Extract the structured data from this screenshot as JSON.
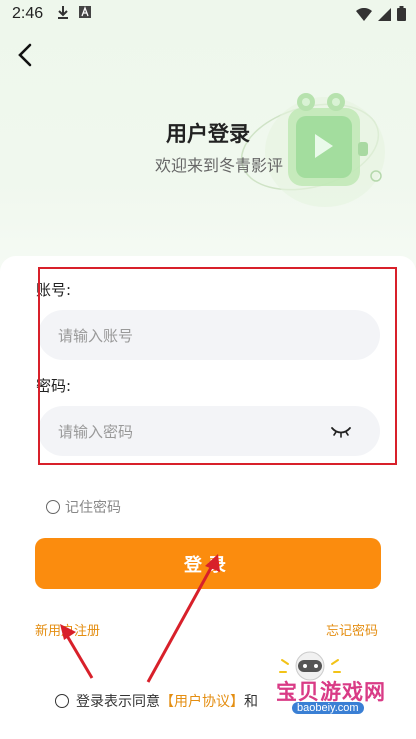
{
  "status_bar": {
    "time": "2:46"
  },
  "header": {
    "title": "用户登录",
    "subtitle": "欢迎来到冬青影评"
  },
  "form": {
    "account_label": "账号:",
    "account_placeholder": "请输入账号",
    "password_label": "密码:",
    "password_placeholder": "请输入密码",
    "remember_label": "记住密码",
    "login_button": "登录",
    "register_link": "新用户注册",
    "forgot_link": "忘记密码"
  },
  "agreement": {
    "prefix": "登录表示同意",
    "user_agreement": "【用户协议】",
    "suffix": "和"
  },
  "watermark": {
    "text": "宝贝游戏网",
    "url": "baobeiy.com"
  },
  "colors": {
    "accent": "#fb8c0e",
    "link": "#e48e12",
    "annotation": "#d8202a"
  }
}
